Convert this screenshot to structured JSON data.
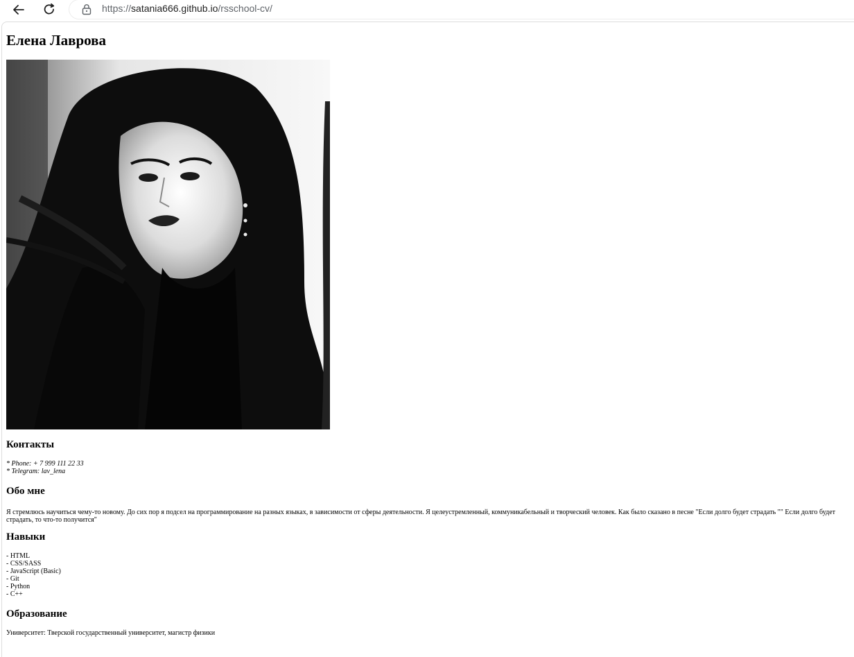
{
  "browser": {
    "url_prefix": "https://",
    "url_host": "satania666.github.io",
    "url_path": "/rsschool-cv/"
  },
  "page": {
    "name": "Елена Лаврова",
    "photo_alt": "",
    "contacts": {
      "heading": "Контакты",
      "items": [
        "* Phone: + 7 999 111 22 33",
        "* Telegram: lav_lena"
      ]
    },
    "about": {
      "heading": "Обо мне",
      "text": "Я стремлюсь научиться чему-то новому. До сих пор я подсел на программирование на разных языках, в зависимости от сферы деятельности. Я целеустремленный, коммуникабельный и творческий человек. Как было сказано в песне \"Если долго будет страдать \"\" Если долго будет страдать, то что-то получится\""
    },
    "skills": {
      "heading": "Навыки",
      "items": [
        "- HTML",
        "- CSS/SASS",
        "- JavaScript (Basic)",
        "- Git",
        "- Python",
        "- C++"
      ]
    },
    "education": {
      "heading": "Образование",
      "text": "Университет: Тверской государственный университет, магистр физики"
    }
  }
}
